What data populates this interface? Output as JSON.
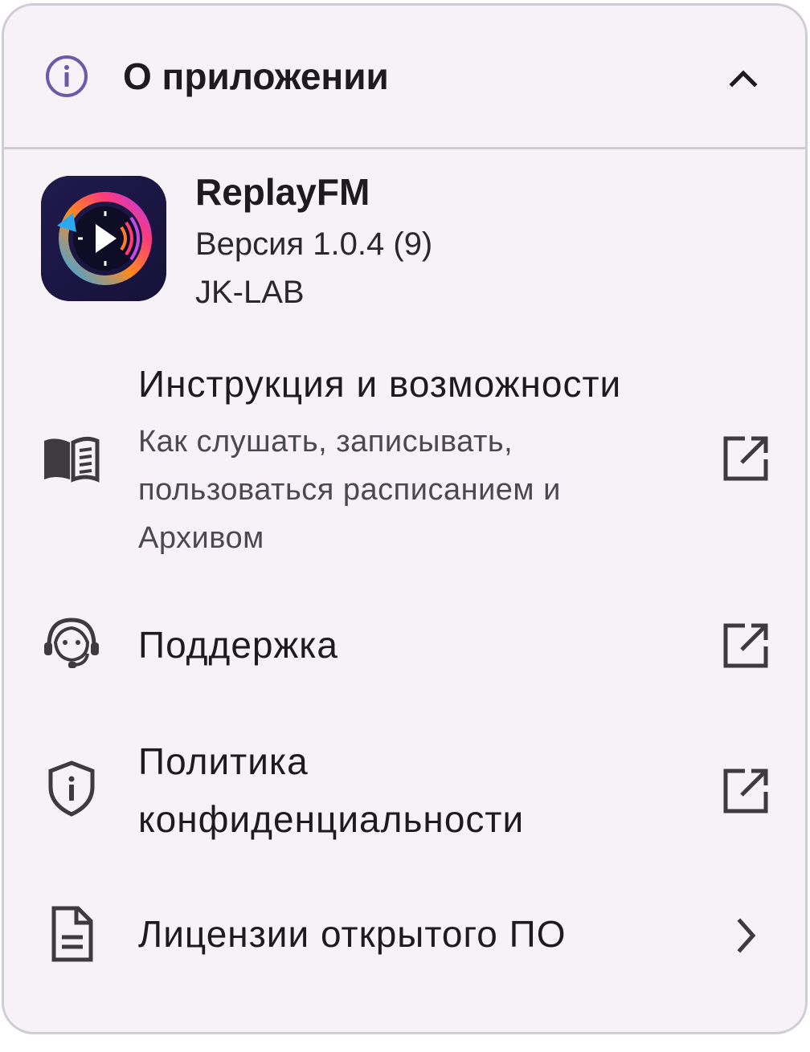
{
  "header": {
    "title": "О приложении",
    "icon": "info-icon",
    "toggle_icon": "chevron-up-icon"
  },
  "app": {
    "name": "ReplayFM",
    "version": "Версия 1.0.4 (9)",
    "developer": "JK-LAB",
    "logo_icon": "replay-radio-logo"
  },
  "items": [
    {
      "label": "Инструкция и возможности",
      "sub_lines": [
        "Как слушать, записывать,",
        "пользоваться расписанием и",
        "Архивом"
      ],
      "icon": "book-icon",
      "trailing_icon": "open-in-new-icon"
    },
    {
      "label": "Поддержка",
      "icon": "support-agent-icon",
      "trailing_icon": "open-in-new-icon"
    },
    {
      "label_lines": [
        "Политика",
        "конфиденциальности"
      ],
      "icon": "privacy-shield-icon",
      "trailing_icon": "open-in-new-icon"
    },
    {
      "label": "Лицензии открытого ПО",
      "icon": "document-icon",
      "trailing_icon": "chevron-right-icon"
    }
  ],
  "colors": {
    "card_background": "#f7f2f8",
    "border": "#cfcdd3",
    "accent_purple": "#6c5aa8",
    "icon_dark": "#3d3b40",
    "text_primary": "#1d1b20",
    "text_secondary": "#4a4850"
  }
}
